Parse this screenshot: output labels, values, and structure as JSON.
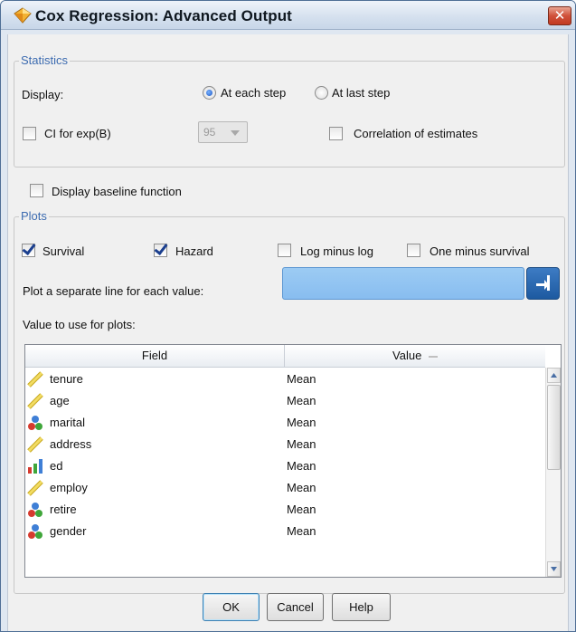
{
  "window": {
    "title": "Cox Regression: Advanced Output",
    "close_label": "✕",
    "title_icon": "diamond-node-icon"
  },
  "statistics": {
    "legend": "Statistics",
    "display_label": "Display:",
    "display_options": [
      {
        "label": "At each step",
        "selected": true
      },
      {
        "label": "At last step",
        "selected": false
      }
    ],
    "ci_label": "CI for exp(B)",
    "ci_checked": false,
    "ci_value": "95",
    "correlation_label": "Correlation of estimates",
    "correlation_checked": false
  },
  "baseline": {
    "label": "Display baseline function",
    "checked": false
  },
  "plots": {
    "legend": "Plots",
    "options": [
      {
        "label": "Survival",
        "checked": true
      },
      {
        "label": "Hazard",
        "checked": true
      },
      {
        "label": "Log minus log",
        "checked": false
      },
      {
        "label": "One minus survival",
        "checked": false
      }
    ],
    "separate_line_label": "Plot a separate line for each value:",
    "separate_line_value": "",
    "value_to_use_label": "Value to use for plots:",
    "table": {
      "columns": [
        "Field",
        "Value"
      ],
      "rows": [
        {
          "field": "tenure",
          "value": "Mean",
          "icon": "ruler-icon"
        },
        {
          "field": "age",
          "value": "Mean",
          "icon": "ruler-icon"
        },
        {
          "field": "marital",
          "value": "Mean",
          "icon": "nominal-icon"
        },
        {
          "field": "address",
          "value": "Mean",
          "icon": "ruler-icon"
        },
        {
          "field": "ed",
          "value": "Mean",
          "icon": "ordinal-icon"
        },
        {
          "field": "employ",
          "value": "Mean",
          "icon": "ruler-icon"
        },
        {
          "field": "retire",
          "value": "Mean",
          "icon": "nominal-icon"
        },
        {
          "field": "gender",
          "value": "Mean",
          "icon": "nominal-icon"
        }
      ]
    }
  },
  "buttons": {
    "ok": "OK",
    "cancel": "Cancel",
    "help": "Help"
  }
}
